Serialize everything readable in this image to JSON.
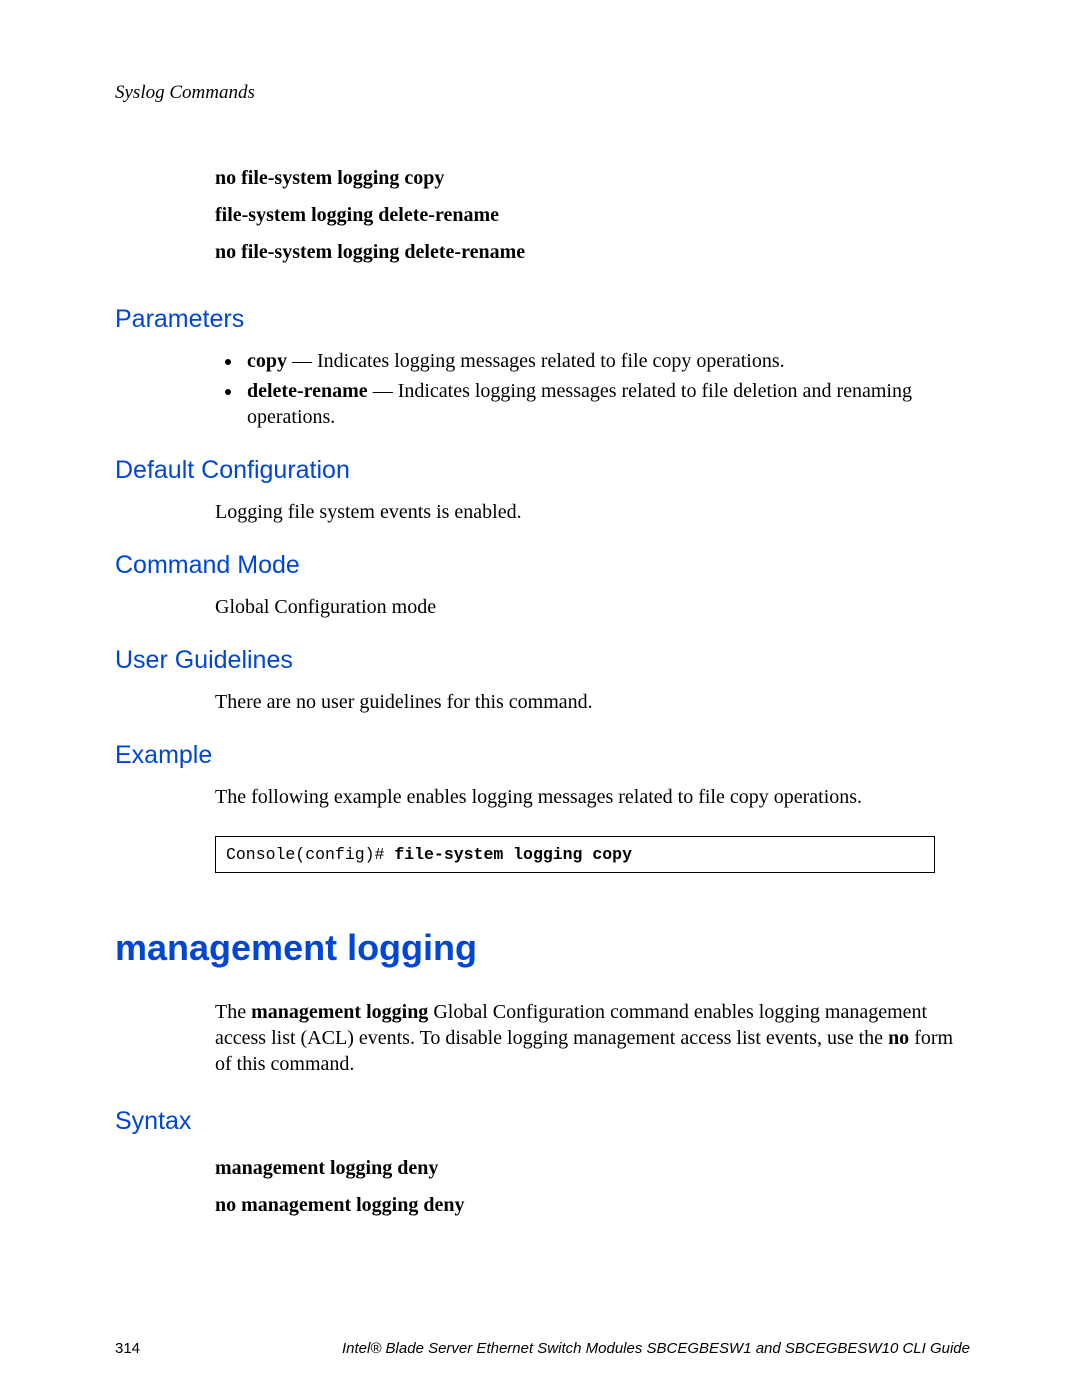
{
  "header": {
    "running": "Syslog Commands"
  },
  "syntax_top": {
    "line1": "no file-system logging copy",
    "line2": "file-system logging delete-rename",
    "line3": "no file-system logging delete-rename"
  },
  "sections": {
    "parameters": {
      "title": "Parameters",
      "items": [
        {
          "term": "copy",
          "desc": " — Indicates logging messages related to file copy operations."
        },
        {
          "term": "delete-rename",
          "desc": " — Indicates logging messages related to file deletion and renaming operations."
        }
      ]
    },
    "default_config": {
      "title": "Default Configuration",
      "body": "Logging file system events is enabled."
    },
    "command_mode": {
      "title": "Command Mode",
      "body": "Global Configuration mode"
    },
    "user_guidelines": {
      "title": "User Guidelines",
      "body": "There are no user guidelines for this command."
    },
    "example": {
      "title": "Example",
      "body": "The following example enables logging messages related to file copy operations.",
      "code_prompt": "Console(config)# ",
      "code_cmd": "file-system logging copy"
    }
  },
  "command2": {
    "title": "management logging",
    "intro_pre": "The ",
    "intro_bold1": "management logging",
    "intro_mid": " Global Configuration command enables logging management access list (ACL) events. To disable logging management access list events, use the ",
    "intro_bold2": "no",
    "intro_post": " form of this command.",
    "syntax_title": "Syntax",
    "syntax_line1": "management logging deny",
    "syntax_line2": "no management logging deny"
  },
  "footer": {
    "page": "314",
    "title": "Intel® Blade Server Ethernet Switch Modules SBCEGBESW1 and SBCEGBESW10 CLI Guide"
  }
}
